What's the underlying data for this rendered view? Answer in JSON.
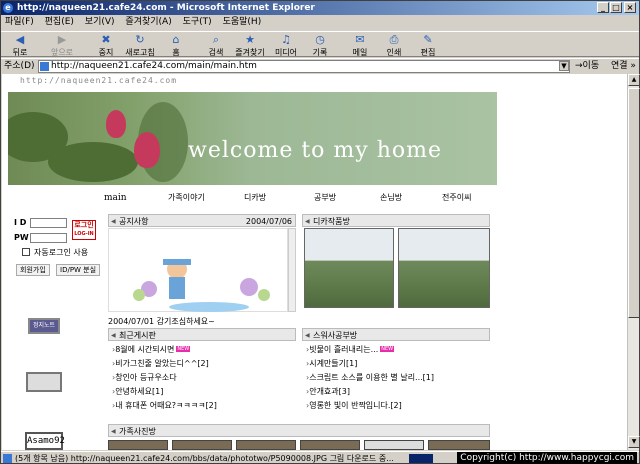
{
  "window": {
    "title": "http://naqueen21.cafe24.com - Microsoft Internet Explorer"
  },
  "menu": [
    "파일(F)",
    "편집(E)",
    "보기(V)",
    "즐겨찾기(A)",
    "도구(T)",
    "도움말(H)"
  ],
  "toolbar": {
    "back": "뒤로",
    "forward": "앞으로",
    "stop": "중지",
    "refresh": "새로고침",
    "home": "홈",
    "search": "검색",
    "favorites": "즐겨찾기",
    "media": "미디어",
    "history": "기록",
    "mail": "메일",
    "print": "인쇄",
    "edit": "편집"
  },
  "address": {
    "label": "주소(D)",
    "url": "http://naqueen21.cafe24.com/main/main.htm",
    "go": "이동",
    "links": "연결 »"
  },
  "page": {
    "site_url_text": "http://naqueen21.cafe24.com",
    "banner_text": "welcome to my home",
    "nav": {
      "main": "main",
      "family": "가족이야기",
      "camera": "디카방",
      "study": "공부방",
      "guest": "손님방",
      "jeonju": "전주이씨"
    },
    "login": {
      "id_label": "I D",
      "pw_label": "PW",
      "button": "로그인",
      "button_sub": "LOG-IN",
      "auto_login": "자동로그인 사용",
      "join": "회원가입",
      "find": "ID/PW 분실"
    },
    "badges": {
      "badge1": "정지노트",
      "badge3": "Asamo92"
    },
    "notice": {
      "title": "공지사항",
      "date": "2004/07/06",
      "line": "2004/07/01 감기조심하세요~"
    },
    "dica": {
      "title": "디카작품방"
    },
    "recent": {
      "title": "최근게시판",
      "items": [
        "8월에 시간되시면",
        "비가그친줄 알았는디^^[2]",
        "창인아 등규우소다",
        "안녕하세요[1]",
        "내 휴대폰 어때요?ㅋㅋㅋㅋ[2]"
      ],
      "new_label": "NEW"
    },
    "study": {
      "title": "스워사공부방",
      "items": [
        "빗물이 흘러내리는...",
        "시계만들기[1]",
        "스크립트 소스를 이용한 별 날리...[1]",
        "안개효과[3]",
        "영롱한 빛이 반짝입니다.[2]"
      ],
      "new_label": "NEW"
    },
    "family_photo": {
      "title": "가족사진방"
    }
  },
  "status": {
    "text": "(5개 항목 남음) http://naqueen21.cafe24.com/bbs/data/phototwo/P5090008.JPG 그림 다운로드 중...",
    "copyright": "Copyright(c) http://www.happycgi.com"
  },
  "colors": {
    "title_bar": "#0a246a",
    "banner_green": "#82a06a",
    "flower_red": "#c53a5c",
    "new_badge": "#e62eaa"
  }
}
